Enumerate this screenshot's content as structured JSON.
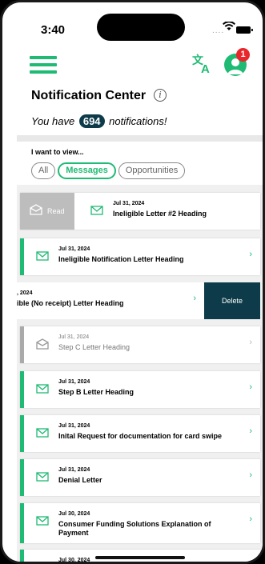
{
  "status": {
    "time": "3:40",
    "signal": "...."
  },
  "header": {
    "badge_count": "1"
  },
  "page": {
    "title": "Notification Center",
    "info_glyph": "i",
    "subtitle_prefix": "You have",
    "count": "694",
    "subtitle_suffix": "notifications!"
  },
  "filter": {
    "label": "I want to view...",
    "options": [
      "All",
      "Messages",
      "Opportunities"
    ],
    "selected": "Messages"
  },
  "actions": {
    "read": "Read",
    "delete": "Delete"
  },
  "notifications": [
    {
      "date": "Jul 31, 2024",
      "heading": "Ineligible Letter #2 Heading",
      "read": false
    },
    {
      "date": "Jul 31, 2024",
      "heading": "Ineligible Notification Letter Heading",
      "read": false
    },
    {
      "date": ", 2024",
      "heading": "ible (No receipt) Letter Heading",
      "read": false
    },
    {
      "date": "Jul 31, 2024",
      "heading": "Step C Letter Heading",
      "read": true
    },
    {
      "date": "Jul 31, 2024",
      "heading": "Step B Letter Heading",
      "read": false
    },
    {
      "date": "Jul 31, 2024",
      "heading": "Inital Request for documentation for card swipe",
      "read": false
    },
    {
      "date": "Jul 31, 2024",
      "heading": "Denial Letter",
      "read": false
    },
    {
      "date": "Jul 30, 2024",
      "heading": "Consumer Funding Solutions Explanation of Payment",
      "read": false
    },
    {
      "date": "Jul 30, 2024",
      "heading": "",
      "read": false
    }
  ],
  "icons": {
    "menu": "hamburger-icon",
    "translate": "translate-icon",
    "profile": "profile-icon",
    "envelope": "envelope-icon",
    "chevron": "chevron-right-icon",
    "info": "info-icon"
  },
  "colors": {
    "accent": "#1fba74",
    "dark": "#0e3b4a",
    "badge": "#e8262b",
    "read_bar": "#aaaaaa"
  }
}
